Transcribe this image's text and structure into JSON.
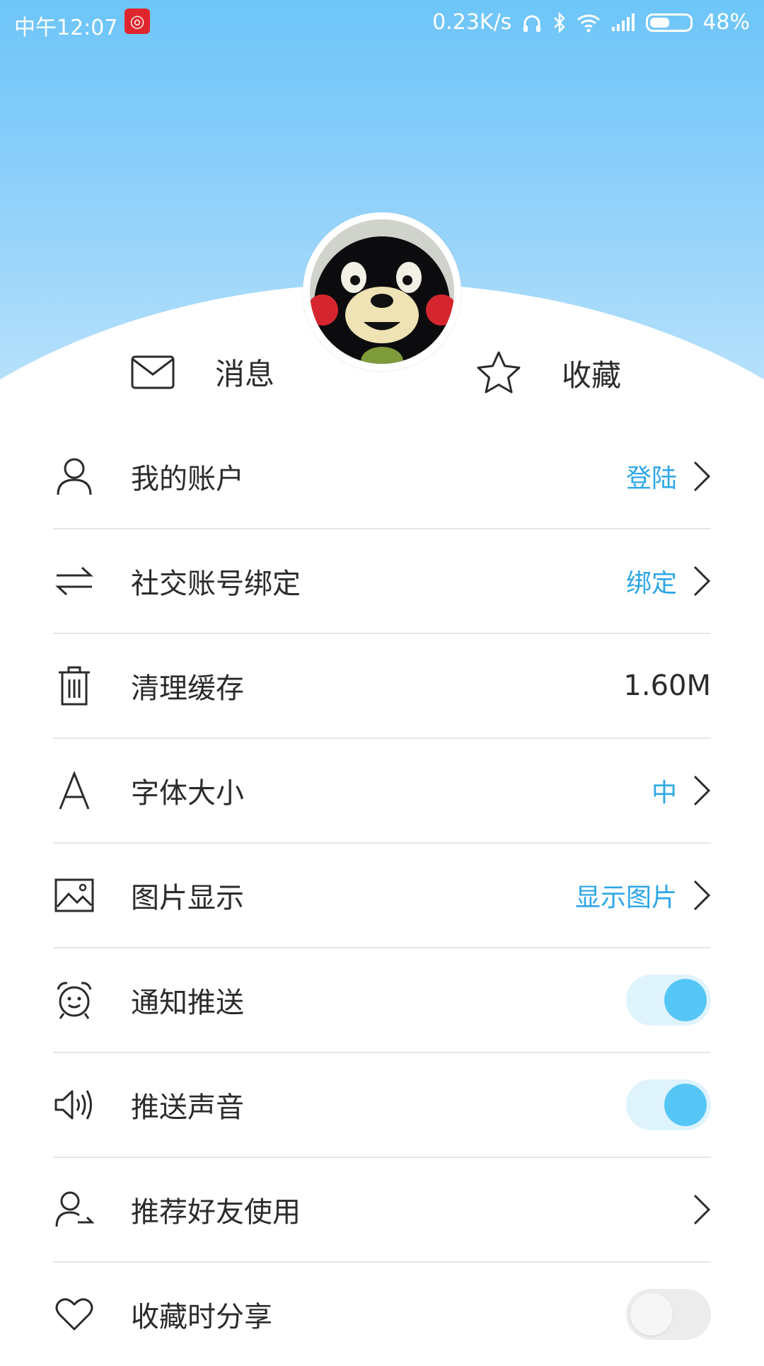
{
  "status_bar": {
    "time": "中午12:07",
    "speed": "0.23K/s",
    "battery": "48%",
    "app_icon": "netease-music-icon"
  },
  "profile": {
    "avatar_icon": "kumamon-avatar"
  },
  "quick_links": {
    "messages": {
      "label": "消息",
      "icon": "envelope-icon"
    },
    "favorites": {
      "label": "收藏",
      "icon": "star-icon"
    }
  },
  "menu": {
    "items": [
      {
        "label": "我的账户",
        "value": "登陆",
        "icon": "user-icon",
        "chevron": true
      },
      {
        "label": "社交账号绑定",
        "value": "绑定",
        "icon": "swap-arrows-icon",
        "chevron": true
      },
      {
        "label": "清理缓存",
        "value": "1.60M",
        "icon": "trash-icon",
        "chevron": false
      },
      {
        "label": "字体大小",
        "value": "中",
        "icon": "font-icon",
        "chevron": true
      },
      {
        "label": "图片显示",
        "value": "显示图片",
        "icon": "image-icon",
        "chevron": true
      },
      {
        "label": "通知推送",
        "toggle": true,
        "icon": "alarm-clock-icon"
      },
      {
        "label": "推送声音",
        "toggle": true,
        "icon": "speaker-icon"
      },
      {
        "label": "推荐好友使用",
        "chevron": true,
        "icon": "user-share-icon"
      },
      {
        "label": "收藏时分享",
        "toggle": false,
        "icon": "heart-icon"
      }
    ]
  },
  "colors": {
    "accent": "#2ea7e7",
    "toggle_on": "#55c6f6",
    "header_top": "#6dc5f8"
  }
}
